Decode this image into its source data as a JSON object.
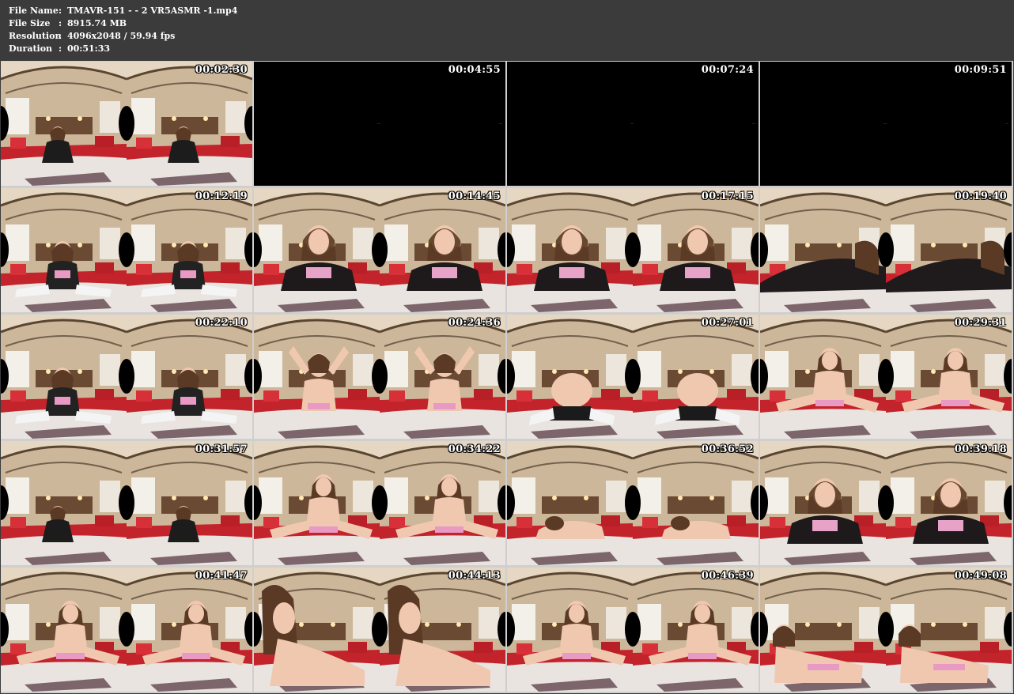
{
  "info": [
    {
      "key": "File Name",
      "sep": ":",
      "value": "TMAVR-151 -   - 2 VR5ASMR  -1.mp4"
    },
    {
      "key": "File Size",
      "sep": ":",
      "value": "8915.74 MB"
    },
    {
      "key": "Resolution",
      "sep": ":",
      "value": "4096x2048 / 59.94 fps"
    },
    {
      "key": "Duration",
      "sep": ":",
      "value": "00:51:33"
    }
  ],
  "thumbnails": [
    {
      "timestamp": "00:02:30",
      "kind": "scene",
      "pose": "sitting-far"
    },
    {
      "timestamp": "00:04:55",
      "kind": "black"
    },
    {
      "timestamp": "00:07:24",
      "kind": "black"
    },
    {
      "timestamp": "00:09:51",
      "kind": "black"
    },
    {
      "timestamp": "00:12:19",
      "kind": "scene",
      "pose": "sitting-mid"
    },
    {
      "timestamp": "00:14:45",
      "kind": "scene",
      "pose": "leaning-close"
    },
    {
      "timestamp": "00:17:15",
      "kind": "scene",
      "pose": "leaning-close"
    },
    {
      "timestamp": "00:19:40",
      "kind": "scene",
      "pose": "lying-lace"
    },
    {
      "timestamp": "00:22:10",
      "kind": "scene",
      "pose": "sitting-mid"
    },
    {
      "timestamp": "00:24:36",
      "kind": "scene",
      "pose": "arms-up"
    },
    {
      "timestamp": "00:27:01",
      "kind": "scene",
      "pose": "rear"
    },
    {
      "timestamp": "00:29:31",
      "kind": "scene",
      "pose": "kneeling"
    },
    {
      "timestamp": "00:31:57",
      "kind": "scene",
      "pose": "sitting-far"
    },
    {
      "timestamp": "00:34:22",
      "kind": "scene",
      "pose": "kneeling"
    },
    {
      "timestamp": "00:36:52",
      "kind": "scene",
      "pose": "lying-low"
    },
    {
      "timestamp": "00:39:18",
      "kind": "scene",
      "pose": "leaning-close"
    },
    {
      "timestamp": "00:41:47",
      "kind": "scene",
      "pose": "kneeling"
    },
    {
      "timestamp": "00:44:13",
      "kind": "scene",
      "pose": "close-side"
    },
    {
      "timestamp": "00:46:39",
      "kind": "scene",
      "pose": "kneeling"
    },
    {
      "timestamp": "00:49:08",
      "kind": "scene",
      "pose": "lying-side"
    }
  ],
  "colors": {
    "header_bg": "#3b3b3b",
    "grid_gap": "#cfcfcf",
    "room_wall": "#cdb79a",
    "ceiling": "#e6d7c3",
    "bed_red": "#c3232a",
    "sheet": "#e9e4e0",
    "skin": "#f0c8b0"
  }
}
